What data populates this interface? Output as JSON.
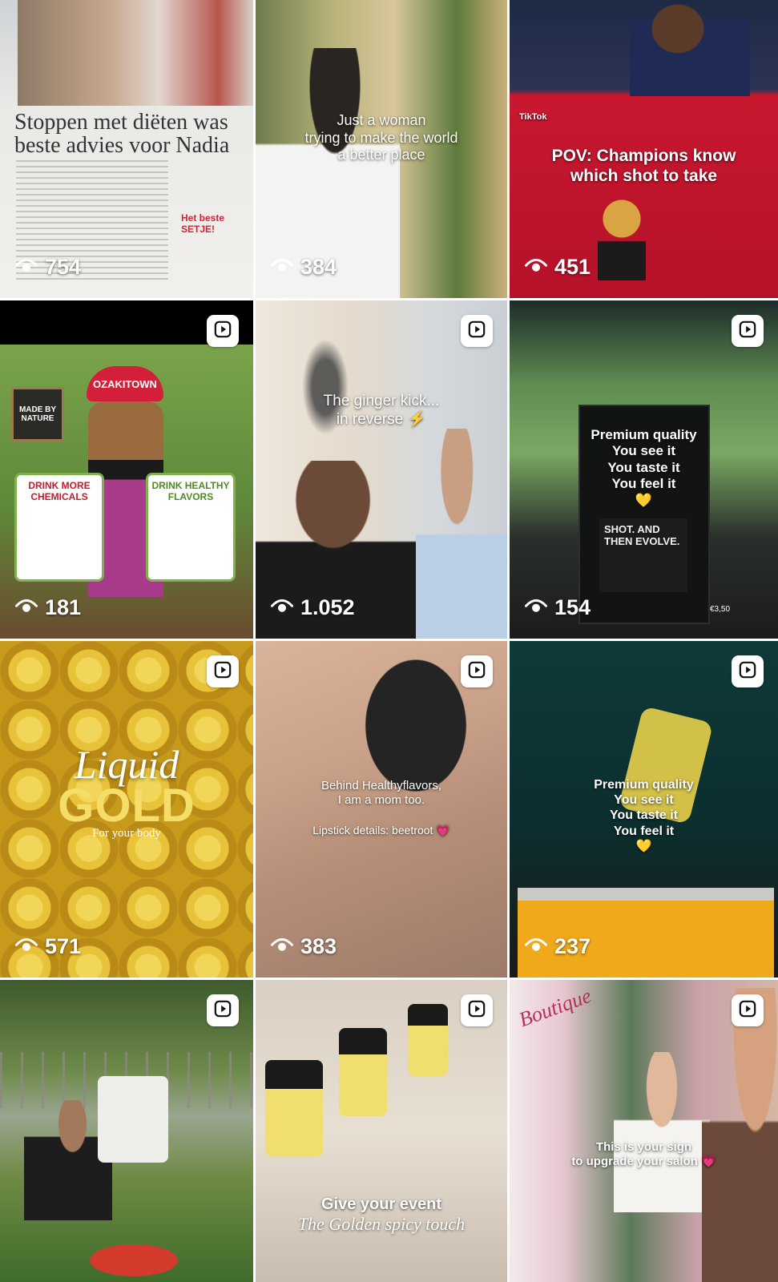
{
  "icons": {
    "views": "eye-icon",
    "video": "play-icon"
  },
  "colors": {
    "overlay_text": "#ffffff",
    "juice_yellow": "#e9c52e",
    "red_backdrop": "#c8182f"
  },
  "tiles": [
    {
      "type": "image",
      "views": "754",
      "newspaper_headline": "Stoppen met diëten was beste advies voor Nadia",
      "newspaper_ad": "Het beste SETJE!"
    },
    {
      "type": "image",
      "views": "384",
      "overlay": "Just a woman\ntrying to make the world\na better place"
    },
    {
      "type": "image",
      "views": "451",
      "overlay": "POV: Champions know\nwhich shot to take",
      "watermark": "TikTok"
    },
    {
      "type": "video",
      "views": "181",
      "cap_text": "OZAKITOWN",
      "sign": "MADE BY NATURE",
      "left_card": "DRINK MORE CHEMICALS",
      "right_card": "DRINK HEALTHY FLAVORS"
    },
    {
      "type": "video",
      "views": "1.052",
      "overlay": "The ginger kick...\nin reverse ⚡"
    },
    {
      "type": "video",
      "views": "154",
      "overlay": "Premium quality\nYou see it\nYou taste it\nYou feel it\n💛",
      "poster": "SHOT. AND THEN EVOLVE.",
      "price": "€3,50"
    },
    {
      "type": "video",
      "views": "571",
      "title": "Liquid",
      "title_gold": "GOLD",
      "subtitle": "For your body"
    },
    {
      "type": "video",
      "views": "383",
      "overlay": "Behind Healthyflavors,\nI am a mom too.",
      "overlay2": "Lipstick details: beetroot 💗"
    },
    {
      "type": "video",
      "views": "237",
      "overlay": "Premium quality\nYou see it\nYou taste it\nYou feel it\n💛"
    },
    {
      "type": "video",
      "views": ""
    },
    {
      "type": "video",
      "views": "",
      "overlay": "Give your event",
      "overlay2": "The Golden spicy touch"
    },
    {
      "type": "video",
      "views": "",
      "overlay": "This is your sign\nto upgrade your salon 💗",
      "salon_sign": "Boutique"
    }
  ]
}
